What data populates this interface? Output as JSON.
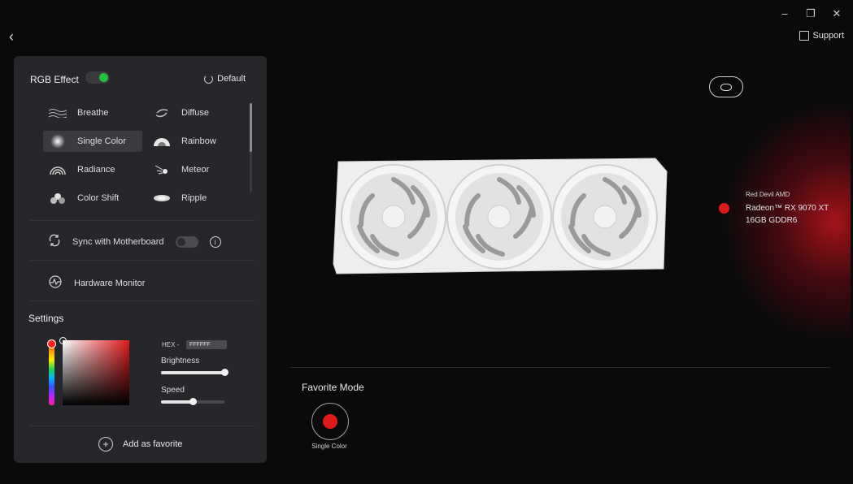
{
  "window": {
    "minimize": "–",
    "maximize": "❐",
    "close": "✕"
  },
  "nav": {
    "back": "‹",
    "support": "Support"
  },
  "rgb": {
    "title": "RGB Effect",
    "enabled": true,
    "default_label": "Default"
  },
  "effects": [
    {
      "label": "Breathe",
      "icon": "breathe-icon",
      "selected": false
    },
    {
      "label": "Diffuse",
      "icon": "diffuse-icon",
      "selected": false
    },
    {
      "label": "Single Color",
      "icon": "single-color-icon",
      "selected": true
    },
    {
      "label": "Rainbow",
      "icon": "rainbow-icon",
      "selected": false
    },
    {
      "label": "Radiance",
      "icon": "radiance-icon",
      "selected": false
    },
    {
      "label": "Meteor",
      "icon": "meteor-icon",
      "selected": false
    },
    {
      "label": "Color Shift",
      "icon": "color-shift-icon",
      "selected": false
    },
    {
      "label": "Ripple",
      "icon": "ripple-icon",
      "selected": false
    }
  ],
  "sync": {
    "label": "Sync with Motherboard",
    "enabled": false
  },
  "hardware": {
    "label": "Hardware Monitor"
  },
  "settings": {
    "title": "Settings",
    "hex_label": "HEX -",
    "hex_value": "FFFFFF",
    "brightness_label": "Brightness",
    "brightness": 1.0,
    "speed_label": "Speed",
    "speed": 0.5
  },
  "add_favorite": "Add as favorite",
  "product": {
    "brand": "Red Devil AMD",
    "name": "Radeon™ RX 9070 XT 16GB GDDR6",
    "color": "#e01a1a"
  },
  "favorite": {
    "title": "Favorite Mode",
    "items": [
      {
        "label": "Single Color",
        "color": "#e01a1a"
      }
    ]
  }
}
